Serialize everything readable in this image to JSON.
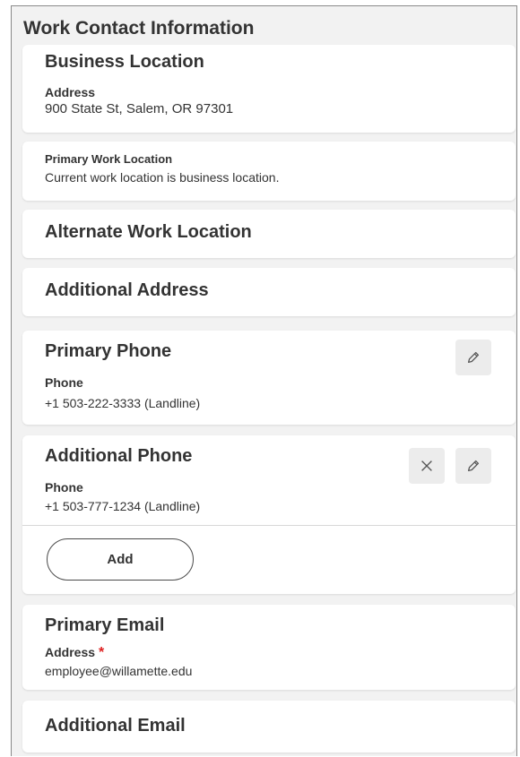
{
  "section_title": "Work Contact Information",
  "business_location": {
    "title": "Business Location",
    "label": "Address",
    "value": "900 State St, Salem, OR 97301"
  },
  "primary_work_location": {
    "label": "Primary Work Location",
    "value": "Current work location is business location."
  },
  "alternate_work_location": {
    "title": "Alternate Work Location"
  },
  "additional_address": {
    "title": "Additional Address"
  },
  "primary_phone": {
    "title": "Primary Phone",
    "label": "Phone",
    "number": "+1 503-222-3333",
    "type": "(Landline)",
    "edit_icon": "pencil-icon"
  },
  "additional_phone": {
    "title": "Additional Phone",
    "label": "Phone",
    "number": "+1 503-777-1234",
    "type": "(Landline)",
    "delete_icon": "close-icon",
    "edit_icon": "pencil-icon",
    "add_label": "Add"
  },
  "primary_email": {
    "title": "Primary Email",
    "label": "Address",
    "required_mark": "*",
    "value": "employee@willamette.edu"
  },
  "additional_email": {
    "title": "Additional Email"
  },
  "colors": {
    "background": "#f2f2f2",
    "card": "#ffffff",
    "text": "#333333",
    "required": "#de1f1f",
    "icon_button": "#ececec"
  }
}
